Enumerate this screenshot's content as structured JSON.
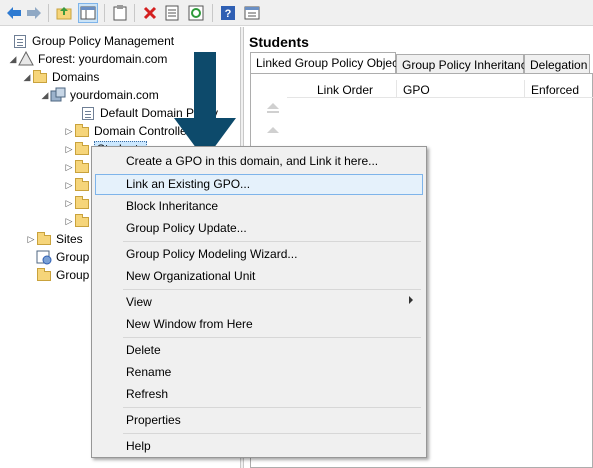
{
  "toolbar": {
    "buttons": [
      "back-icon",
      "forward-icon",
      "up-folder-icon",
      "show-hide-tree-icon",
      "clipboard-icon",
      "delete-icon",
      "properties-icon",
      "refresh-icon",
      "help-icon",
      "view-icon"
    ]
  },
  "tree": {
    "root": "Group Policy Management",
    "forest": "Forest: yourdomain.com",
    "domains": "Domains",
    "domain": "yourdomain.com",
    "default_policy": "Default Domain Policy",
    "domain_controllers": "Domain Controllers",
    "students": "Students",
    "sites": "Sites",
    "group_policy_modeling": "Group Policy Modeling",
    "group_policy_results": "Group Policy Results"
  },
  "right_pane": {
    "title": "Students",
    "tabs": [
      "Linked Group Policy Objects",
      "Group Policy Inheritance",
      "Delegation"
    ],
    "columns": [
      "Link Order",
      "GPO",
      "Enforced"
    ]
  },
  "context_menu": {
    "items": [
      "Create a GPO in this domain, and Link it here...",
      "Link an Existing GPO...",
      "Block Inheritance",
      "Group Policy Update...",
      "Group Policy Modeling Wizard...",
      "New Organizational Unit",
      "View",
      "New Window from Here",
      "Delete",
      "Rename",
      "Refresh",
      "Properties",
      "Help"
    ],
    "highlighted": "Link an Existing GPO..."
  },
  "colors": {
    "annotation_arrow": "#0d4a6b",
    "menu_highlight": "#e5f1fb",
    "tree_selection": "#cce8ff"
  }
}
